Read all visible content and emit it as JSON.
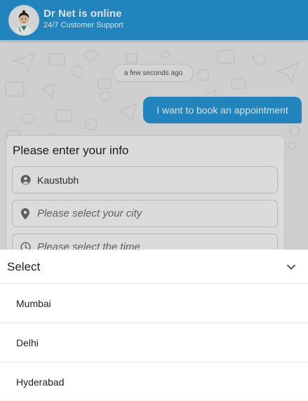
{
  "header": {
    "title": "Dr Net is online",
    "subtitle": "24/7 Customer Support",
    "avatar_icon": "doctor-avatar-icon",
    "color": "#2797d8"
  },
  "chat": {
    "timestamp": "a few seconds ago",
    "user_message": "I want to book an appointment"
  },
  "form": {
    "title": "Please enter your info",
    "name_value": "Kaustubh",
    "city_placeholder": "Please select your city",
    "time_placeholder": "Please select the time"
  },
  "select_sheet": {
    "title": "Select",
    "options": [
      "Mumbai",
      "Delhi",
      "Hyderabad"
    ]
  }
}
